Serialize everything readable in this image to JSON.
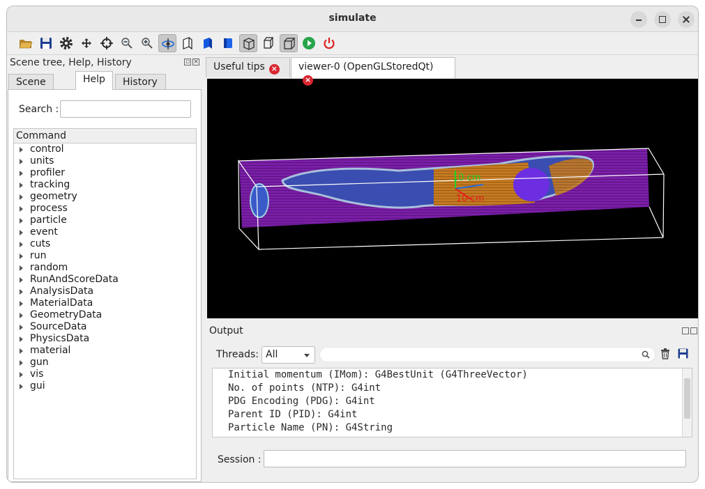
{
  "window": {
    "title": "simulate"
  },
  "toolbar": {
    "buttons": [
      "open-icon",
      "save-icon",
      "settings-icon",
      "move-icon",
      "pick-icon",
      "zoom-out-icon",
      "zoom-in-icon",
      "rotate-icon",
      "hidden-line-icon",
      "solid-icon",
      "surface-icon",
      "perspective-icon",
      "wireframe-icon",
      "ortho-icon",
      "run-icon",
      "power-icon"
    ]
  },
  "left_dock": {
    "title": "Scene tree, Help, History",
    "tabs": [
      "Scene tree",
      "Help",
      "History"
    ],
    "active_tab": "Help",
    "search_label": "Search :",
    "search_value": "",
    "tree_header": "Command",
    "commands": [
      "control",
      "units",
      "profiler",
      "tracking",
      "geometry",
      "process",
      "particle",
      "event",
      "cuts",
      "run",
      "random",
      "RunAndScoreData",
      "AnalysisData",
      "MaterialData",
      "GeometryData",
      "SourceData",
      "PhysicsData",
      "material",
      "gun",
      "vis",
      "gui"
    ]
  },
  "viewer_tabs": [
    {
      "label": "Useful tips"
    },
    {
      "label": "viewer-0 (OpenGLStoredQt)"
    }
  ],
  "viewer": {
    "axis_labels": {
      "y": "10 cm",
      "x": "10 cm"
    }
  },
  "output": {
    "title": "Output",
    "threads_label": "Threads:",
    "threads_value": "All",
    "lines": [
      "Initial momentum (IMom): G4BestUnit (G4ThreeVector)",
      "No. of points (NTP): G4int",
      "PDG Encoding (PDG): G4int",
      "Parent ID (PID): G4int",
      "Particle Name (PN): G4String"
    ]
  },
  "session": {
    "label": "Session :",
    "value": ""
  }
}
